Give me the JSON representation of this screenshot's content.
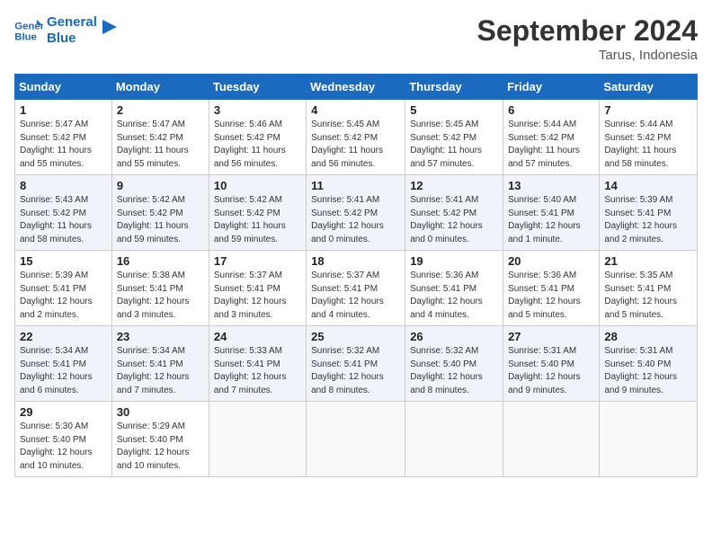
{
  "header": {
    "logo_line1": "General",
    "logo_line2": "Blue",
    "month": "September 2024",
    "location": "Tarus, Indonesia"
  },
  "weekdays": [
    "Sunday",
    "Monday",
    "Tuesday",
    "Wednesday",
    "Thursday",
    "Friday",
    "Saturday"
  ],
  "weeks": [
    [
      {
        "day": "1",
        "info": "Sunrise: 5:47 AM\nSunset: 5:42 PM\nDaylight: 11 hours\nand 55 minutes."
      },
      {
        "day": "2",
        "info": "Sunrise: 5:47 AM\nSunset: 5:42 PM\nDaylight: 11 hours\nand 55 minutes."
      },
      {
        "day": "3",
        "info": "Sunrise: 5:46 AM\nSunset: 5:42 PM\nDaylight: 11 hours\nand 56 minutes."
      },
      {
        "day": "4",
        "info": "Sunrise: 5:45 AM\nSunset: 5:42 PM\nDaylight: 11 hours\nand 56 minutes."
      },
      {
        "day": "5",
        "info": "Sunrise: 5:45 AM\nSunset: 5:42 PM\nDaylight: 11 hours\nand 57 minutes."
      },
      {
        "day": "6",
        "info": "Sunrise: 5:44 AM\nSunset: 5:42 PM\nDaylight: 11 hours\nand 57 minutes."
      },
      {
        "day": "7",
        "info": "Sunrise: 5:44 AM\nSunset: 5:42 PM\nDaylight: 11 hours\nand 58 minutes."
      }
    ],
    [
      {
        "day": "8",
        "info": "Sunrise: 5:43 AM\nSunset: 5:42 PM\nDaylight: 11 hours\nand 58 minutes."
      },
      {
        "day": "9",
        "info": "Sunrise: 5:42 AM\nSunset: 5:42 PM\nDaylight: 11 hours\nand 59 minutes."
      },
      {
        "day": "10",
        "info": "Sunrise: 5:42 AM\nSunset: 5:42 PM\nDaylight: 11 hours\nand 59 minutes."
      },
      {
        "day": "11",
        "info": "Sunrise: 5:41 AM\nSunset: 5:42 PM\nDaylight: 12 hours\nand 0 minutes."
      },
      {
        "day": "12",
        "info": "Sunrise: 5:41 AM\nSunset: 5:42 PM\nDaylight: 12 hours\nand 0 minutes."
      },
      {
        "day": "13",
        "info": "Sunrise: 5:40 AM\nSunset: 5:41 PM\nDaylight: 12 hours\nand 1 minute."
      },
      {
        "day": "14",
        "info": "Sunrise: 5:39 AM\nSunset: 5:41 PM\nDaylight: 12 hours\nand 2 minutes."
      }
    ],
    [
      {
        "day": "15",
        "info": "Sunrise: 5:39 AM\nSunset: 5:41 PM\nDaylight: 12 hours\nand 2 minutes."
      },
      {
        "day": "16",
        "info": "Sunrise: 5:38 AM\nSunset: 5:41 PM\nDaylight: 12 hours\nand 3 minutes."
      },
      {
        "day": "17",
        "info": "Sunrise: 5:37 AM\nSunset: 5:41 PM\nDaylight: 12 hours\nand 3 minutes."
      },
      {
        "day": "18",
        "info": "Sunrise: 5:37 AM\nSunset: 5:41 PM\nDaylight: 12 hours\nand 4 minutes."
      },
      {
        "day": "19",
        "info": "Sunrise: 5:36 AM\nSunset: 5:41 PM\nDaylight: 12 hours\nand 4 minutes."
      },
      {
        "day": "20",
        "info": "Sunrise: 5:36 AM\nSunset: 5:41 PM\nDaylight: 12 hours\nand 5 minutes."
      },
      {
        "day": "21",
        "info": "Sunrise: 5:35 AM\nSunset: 5:41 PM\nDaylight: 12 hours\nand 5 minutes."
      }
    ],
    [
      {
        "day": "22",
        "info": "Sunrise: 5:34 AM\nSunset: 5:41 PM\nDaylight: 12 hours\nand 6 minutes."
      },
      {
        "day": "23",
        "info": "Sunrise: 5:34 AM\nSunset: 5:41 PM\nDaylight: 12 hours\nand 7 minutes."
      },
      {
        "day": "24",
        "info": "Sunrise: 5:33 AM\nSunset: 5:41 PM\nDaylight: 12 hours\nand 7 minutes."
      },
      {
        "day": "25",
        "info": "Sunrise: 5:32 AM\nSunset: 5:41 PM\nDaylight: 12 hours\nand 8 minutes."
      },
      {
        "day": "26",
        "info": "Sunrise: 5:32 AM\nSunset: 5:40 PM\nDaylight: 12 hours\nand 8 minutes."
      },
      {
        "day": "27",
        "info": "Sunrise: 5:31 AM\nSunset: 5:40 PM\nDaylight: 12 hours\nand 9 minutes."
      },
      {
        "day": "28",
        "info": "Sunrise: 5:31 AM\nSunset: 5:40 PM\nDaylight: 12 hours\nand 9 minutes."
      }
    ],
    [
      {
        "day": "29",
        "info": "Sunrise: 5:30 AM\nSunset: 5:40 PM\nDaylight: 12 hours\nand 10 minutes."
      },
      {
        "day": "30",
        "info": "Sunrise: 5:29 AM\nSunset: 5:40 PM\nDaylight: 12 hours\nand 10 minutes."
      },
      {
        "day": "",
        "info": ""
      },
      {
        "day": "",
        "info": ""
      },
      {
        "day": "",
        "info": ""
      },
      {
        "day": "",
        "info": ""
      },
      {
        "day": "",
        "info": ""
      }
    ]
  ]
}
